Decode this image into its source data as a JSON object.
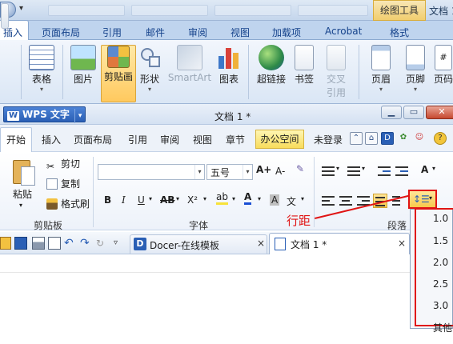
{
  "outer_window": {
    "title_tool": "绘图工具",
    "doc_title": "文档 1",
    "tabs": [
      "插入",
      "页面布局",
      "引用",
      "邮件",
      "审阅",
      "视图",
      "加载项",
      "Acrobat",
      "格式"
    ],
    "ribbon_buttons": [
      "表格",
      "图片",
      "剪贴画",
      "形状",
      "SmartArt",
      "图表",
      "超链接",
      "书签",
      "交叉",
      "引用",
      "页眉",
      "页脚",
      "页码"
    ]
  },
  "wps": {
    "app_name": "WPS 文字",
    "doc_title": "文档 1 *",
    "menu_tabs": [
      "开始",
      "插入",
      "页面布局",
      "引用",
      "审阅",
      "视图",
      "章节"
    ],
    "office_space": "办公空间",
    "login": "未登录",
    "clipboard": {
      "paste": "粘贴",
      "cut": "剪切",
      "copy": "复制",
      "format_painter": "格式刷",
      "group_label": "剪贴板"
    },
    "font": {
      "font_name": "",
      "font_size": "五号",
      "bold": "B",
      "italic": "I",
      "underline": "U",
      "strike": "AB",
      "superscript": "X²",
      "highlight": "ab",
      "font_color": "A",
      "char_shade": "A",
      "phonetic": "文",
      "grow": "A+",
      "shrink": "A-",
      "group_label": "字体"
    },
    "paragraph": {
      "group_label": "段落",
      "line_spacing_callout": "行距",
      "line_spacing_options": [
        "1.0",
        "1.5",
        "2.0",
        "2.5",
        "3.0"
      ],
      "line_spacing_more": "其他"
    },
    "doc_tabs": [
      {
        "label": "Docer-在线模板",
        "close": "×"
      },
      {
        "label": "文档 1 *",
        "close": "×"
      }
    ]
  },
  "colors": {
    "accent_blue": "#2a5fb5",
    "highlight_red": "#e01414",
    "active_yellow": "#f7c94b"
  }
}
